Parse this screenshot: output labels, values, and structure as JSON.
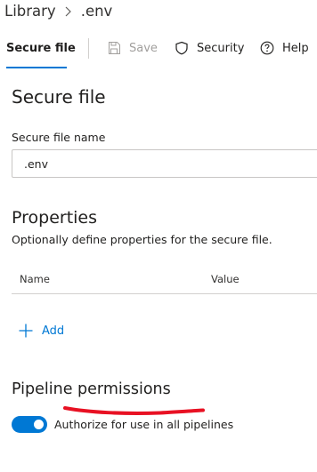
{
  "breadcrumb": {
    "root": "Library",
    "separator_icon": "chevron-right-icon",
    "current": ".env"
  },
  "toolbar": {
    "active_tab": "Secure file",
    "save_label": "Save",
    "save_enabled": false,
    "security_label": "Security",
    "help_label": "Help",
    "accent_color": "#0078d4"
  },
  "secure_file": {
    "heading": "Secure file",
    "name_label": "Secure file name",
    "name_value": ".env"
  },
  "properties": {
    "heading": "Properties",
    "description": "Optionally define properties for the secure file.",
    "columns": [
      "Name",
      "Value"
    ],
    "add_label": "Add"
  },
  "pipeline_permissions": {
    "heading": "Pipeline permissions",
    "toggle_label": "Authorize for use in all pipelines",
    "toggle_on": true,
    "annotation_color": "#e81123"
  }
}
